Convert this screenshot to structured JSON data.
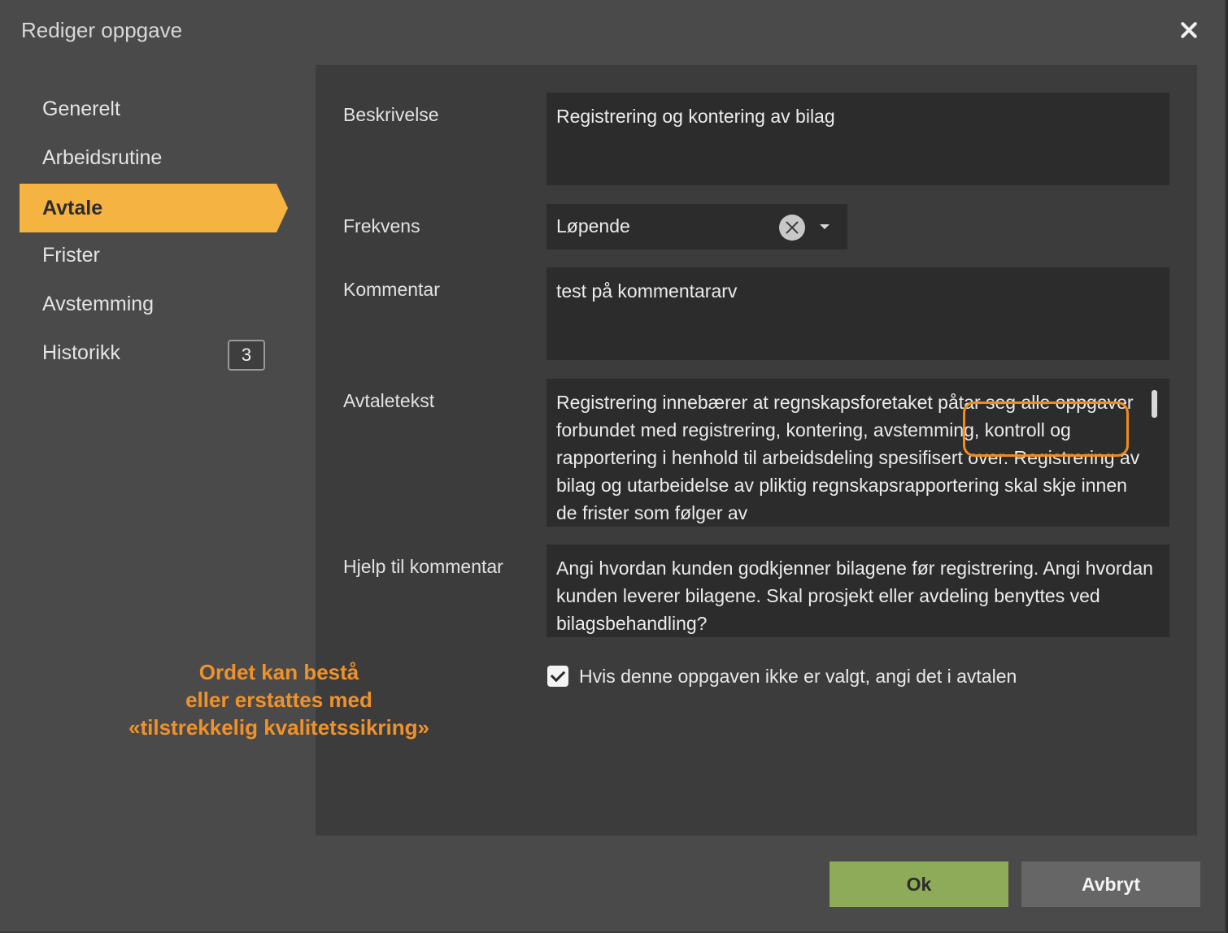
{
  "dialog": {
    "title": "Rediger oppgave"
  },
  "sidebar": {
    "items": [
      {
        "label": "Generelt"
      },
      {
        "label": "Arbeidsrutine"
      },
      {
        "label": "Avtale"
      },
      {
        "label": "Frister"
      },
      {
        "label": "Avstemming"
      },
      {
        "label": "Historikk",
        "badge": "3"
      }
    ],
    "active_index": 2
  },
  "form": {
    "beskrivelse": {
      "label": "Beskrivelse",
      "value": "Registrering og kontering av bilag"
    },
    "frekvens": {
      "label": "Frekvens",
      "value": "Løpende"
    },
    "kommentar": {
      "label": "Kommentar",
      "value": "test på kommentararv"
    },
    "avtaletekst": {
      "label": "Avtaletekst",
      "value": "Registrering innebærer at regnskapsforetaket påtar seg alle oppgaver forbundet med registrering, kontering, avstemming, kontroll og rapportering i henhold til arbeidsdeling spesifisert over. Registrering av bilag og utarbeidelse av pliktig regnskapsrapportering skal skje innen de frister som følger av"
    },
    "hjelp": {
      "label": "Hjelp til kommentar",
      "value": "Angi hvordan kunden godkjenner bilagene før registrering.  Angi hvordan kunden leverer bilagene.  Skal prosjekt eller avdeling benyttes ved bilagsbehandling?"
    },
    "checkbox": {
      "label": "Hvis denne oppgaven ikke er valgt, angi det i avtalen",
      "checked": true
    }
  },
  "annotation": {
    "line1": "Ordet kan bestå",
    "line2": "eller erstattes med",
    "line3": "«tilstrekkelig kvalitetssikring»",
    "color": "#f0922a"
  },
  "buttons": {
    "ok": "Ok",
    "cancel": "Avbryt"
  },
  "colors": {
    "accent": "#f5b342",
    "ok_button": "#8dab59",
    "highlight": "#f08c1c"
  }
}
